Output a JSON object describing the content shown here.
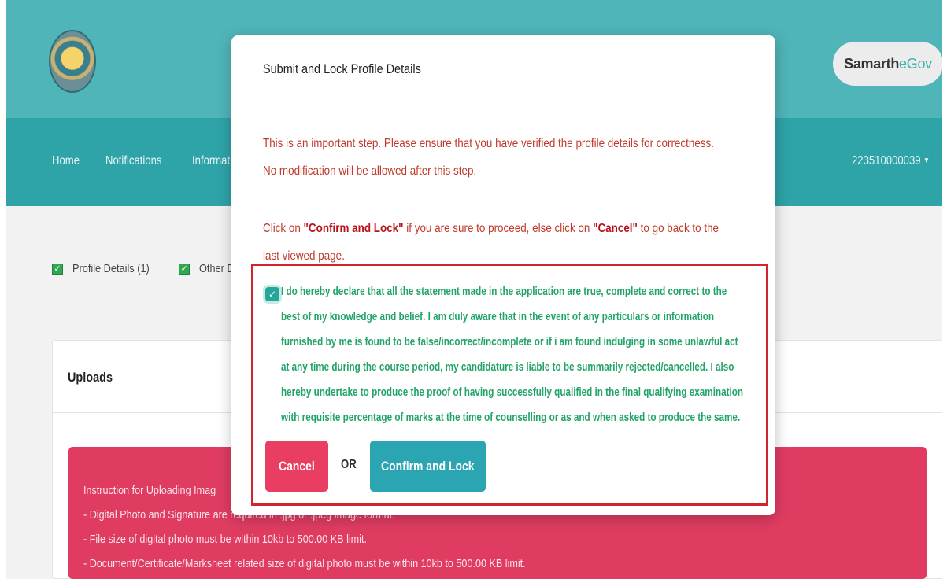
{
  "app": {
    "brand_primary": "Samarth",
    "brand_secondary": "eGov",
    "accent_color": "#2ea3a8",
    "danger_color": "#ea3d62"
  },
  "nav": {
    "items": [
      "Home",
      "Notifications",
      "Informat"
    ],
    "user": "223510000039"
  },
  "steps": [
    {
      "label": "Profile Details  (1)",
      "checked": true
    },
    {
      "label": "Other Det",
      "checked": true
    }
  ],
  "uploads": {
    "title": "Uploads",
    "instructions": [
      "Instruction for Uploading Imag",
      "- Digital Photo and Signature are required in .jpg or .jpeg image format.",
      "- File size of digital photo must be within 10kb to 500.00 KB limit.",
      "- Document/Certificate/Marksheet related size of digital photo must be within 10kb to 500.00 KB limit."
    ]
  },
  "modal": {
    "title": "Submit and Lock Profile Details",
    "warning_lines": [
      "This is an important step. Please ensure that you have verified the profile details for correctness.",
      "No modification will be allowed after this step."
    ],
    "instruction_pre": "Click on ",
    "instruction_confirm": "\"Confirm and Lock\"",
    "instruction_mid": " if you are sure to proceed, else click on ",
    "instruction_cancel": "\"Cancel\"",
    "instruction_post": " to go back to the",
    "instruction_line2": "last viewed page.",
    "declaration_checked": true,
    "declaration_lines": [
      "I do hereby declare that all the statement made in the application are true, complete and correct to the",
      "best of my knowledge and belief. I am duly aware that in the event of any particulars or information",
      "furnished by me is found to be false/incorrect/incomplete or if i am found indulging in some unlawful act",
      "at any time during the course period, my candidature is liable to be summarily rejected/cancelled. I also",
      "hereby undertake to produce the proof of having successfully qualified in the final qualifying examination",
      "with requisite percentage of marks at the time of counselling or as and when asked to produce the same."
    ],
    "cancel_label": "Cancel",
    "or_label": "OR",
    "confirm_label": "Confirm and Lock"
  }
}
